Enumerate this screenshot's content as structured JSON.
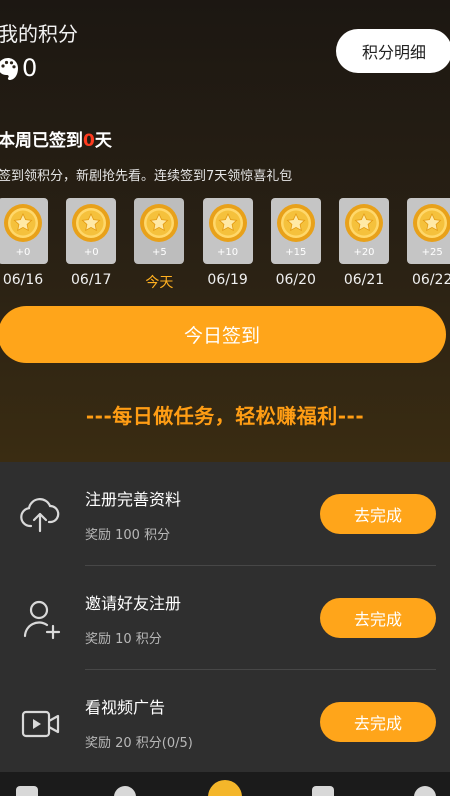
{
  "header": {
    "title": "我的积分",
    "points": "0",
    "detail_button": "积分明细"
  },
  "signin": {
    "week_prefix": "本周已签到",
    "week_count": "0",
    "week_suffix": "天",
    "description": "签到领积分，新剧抢先看。连续签到7天领惊喜礼包",
    "days": [
      {
        "amount": "+0",
        "label": "06/16",
        "today": false
      },
      {
        "amount": "+0",
        "label": "06/17",
        "today": false
      },
      {
        "amount": "+5",
        "label": "今天",
        "today": true
      },
      {
        "amount": "+10",
        "label": "06/19",
        "today": false
      },
      {
        "amount": "+15",
        "label": "06/20",
        "today": false
      },
      {
        "amount": "+20",
        "label": "06/21",
        "today": false
      },
      {
        "amount": "+25",
        "label": "06/22",
        "today": false
      }
    ],
    "button": "今日签到"
  },
  "tasks_banner": "---每日做任务，轻松赚福利---",
  "tasks": [
    {
      "icon": "cloud-upload-icon",
      "name": "注册完善资料",
      "reward": "奖励 100 积分",
      "button": "去完成"
    },
    {
      "icon": "add-user-icon",
      "name": "邀请好友注册",
      "reward": "奖励 10 积分",
      "button": "去完成"
    },
    {
      "icon": "video-icon",
      "name": "看视频广告",
      "reward": "奖励 20 积分(0/5)",
      "button": "去完成"
    }
  ],
  "colors": {
    "accent": "#ffa51a",
    "highlight": "#ff3b1f"
  }
}
